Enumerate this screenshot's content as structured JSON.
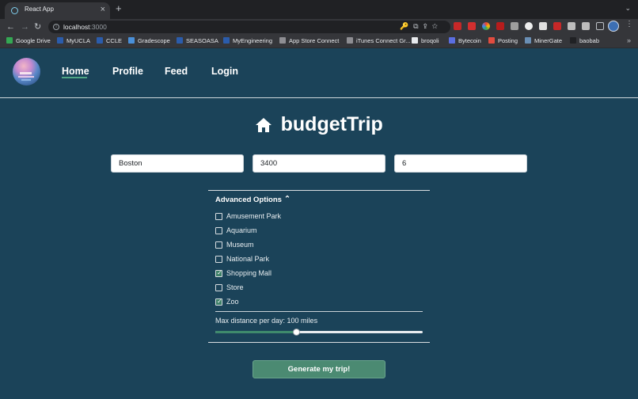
{
  "browser": {
    "tab_title": "React App",
    "tab_close": "×",
    "new_tab": "+",
    "tab_menu": "⌄",
    "url_host": "localhost",
    "url_port": ":3000",
    "nav": {
      "back": "←",
      "forward": "→",
      "reload": "↻"
    },
    "omnibox_icons": "🔑⧉⇪☆",
    "kebab": "⋮",
    "bookmarks_more": "»",
    "bookmarks": [
      {
        "label": "Google Drive",
        "icon_color": "#34a853"
      },
      {
        "label": "MyUCLA",
        "icon_color": "#2b5cab"
      },
      {
        "label": "CCLE",
        "icon_color": "#2b5cab"
      },
      {
        "label": "Gradescope",
        "icon_color": "#4a90d9"
      },
      {
        "label": "SEASOASA",
        "icon_color": "#2b5cab"
      },
      {
        "label": "MyEngineering",
        "icon_color": "#2b5cab"
      },
      {
        "label": "App Store Connect",
        "icon_color": "#8e8e93"
      },
      {
        "label": "iTunes Connect Gr...",
        "icon_color": "#8e8e93"
      },
      {
        "label": "broqoli",
        "icon_color": "#e8eaed"
      },
      {
        "label": "Bytecoin",
        "icon_color": "#5b6ee1"
      },
      {
        "label": "Posting",
        "icon_color": "#e24c3f"
      },
      {
        "label": "MinerGate",
        "icon_color": "#6a8fb5"
      },
      {
        "label": "baobab",
        "icon_color": "#202124"
      }
    ]
  },
  "app": {
    "nav_links": [
      "Home",
      "Profile",
      "Feed",
      "Login"
    ],
    "active_nav": "Home",
    "title": "budgetTrip",
    "inputs": [
      {
        "name": "destination",
        "value": "Boston"
      },
      {
        "name": "budget",
        "value": "3400"
      },
      {
        "name": "days",
        "value": "6"
      }
    ],
    "advanced_label": "Advanced Options",
    "advanced_caret": "⌃",
    "options": [
      {
        "label": "Amusement Park",
        "checked": false
      },
      {
        "label": "Aquarium",
        "checked": false
      },
      {
        "label": "Museum",
        "checked": false
      },
      {
        "label": "National Park",
        "checked": false
      },
      {
        "label": "Shopping Mall",
        "checked": true
      },
      {
        "label": "Store",
        "checked": false
      },
      {
        "label": "Zoo",
        "checked": true
      }
    ],
    "checkmark": "✓",
    "distance_label": "Max distance per day: 100 miles",
    "distance_fraction": 0.39,
    "generate_label": "Generate my trip!",
    "colors": {
      "accent": "#4b8a72",
      "background": "#1b4359"
    }
  }
}
